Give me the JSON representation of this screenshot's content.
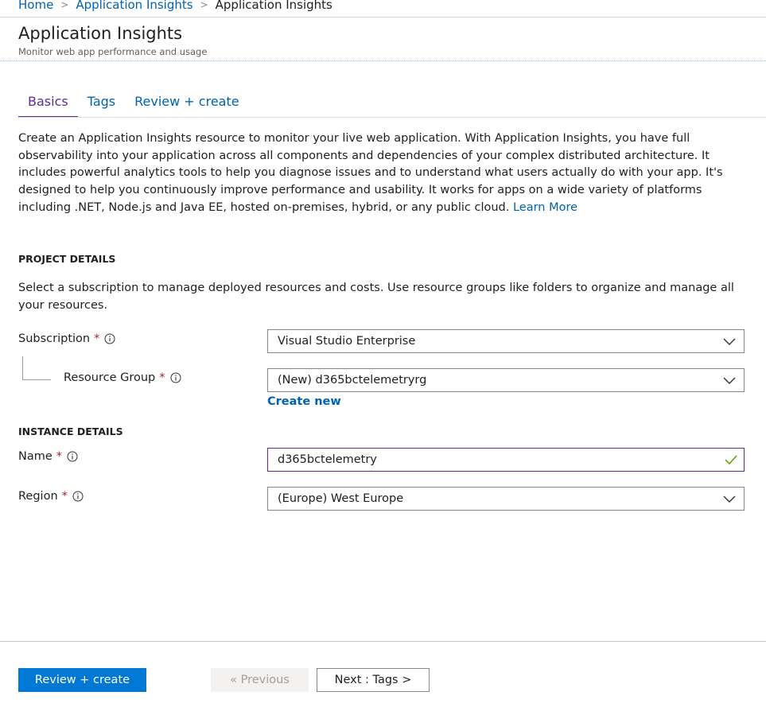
{
  "breadcrumb": {
    "items": [
      "Home",
      "Application Insights"
    ],
    "current": "Application Insights",
    "separator": ">"
  },
  "header": {
    "title": "Application Insights",
    "subtitle": "Monitor web app performance and usage"
  },
  "tabs": [
    {
      "label": "Basics",
      "active": true
    },
    {
      "label": "Tags",
      "active": false
    },
    {
      "label": "Review + create",
      "active": false
    }
  ],
  "intro": {
    "text": "Create an Application Insights resource to monitor your live web application. With Application Insights, you have full observability into your application across all components and dependencies of your complex distributed architecture. It includes powerful analytics tools to help you diagnose issues and to understand what users actually do with your app. It's designed to help you continuously improve performance and usability. It works for apps on a wide variety of platforms including .NET, Node.js and Java EE, hosted on-premises, hybrid, or any public cloud.",
    "link": "Learn More"
  },
  "project": {
    "heading": "PROJECT DETAILS",
    "description": "Select a subscription to manage deployed resources and costs. Use resource groups like folders to organize and manage all your resources.",
    "subscription": {
      "label": "Subscription",
      "required": "*",
      "value": "Visual Studio Enterprise"
    },
    "resource_group": {
      "label": "Resource Group",
      "required": "*",
      "value": "(New) d365bctelemetryrg",
      "create_new": "Create new"
    }
  },
  "instance": {
    "heading": "INSTANCE DETAILS",
    "name": {
      "label": "Name",
      "required": "*",
      "value": "d365bctelemetry"
    },
    "region": {
      "label": "Region",
      "required": "*",
      "value": "(Europe) West Europe"
    }
  },
  "footer": {
    "review_create": "Review + create",
    "previous": "« Previous",
    "next": "Next : Tags >"
  },
  "icons": {
    "info": "info-circle-icon",
    "chevron": "chevron-down-icon",
    "check": "checkmark-icon"
  },
  "colors": {
    "accent": "#0078d4",
    "link": "#0063b1",
    "active_tab": "#5c2d91",
    "required": "#a4262c",
    "valid": "#57a300"
  }
}
